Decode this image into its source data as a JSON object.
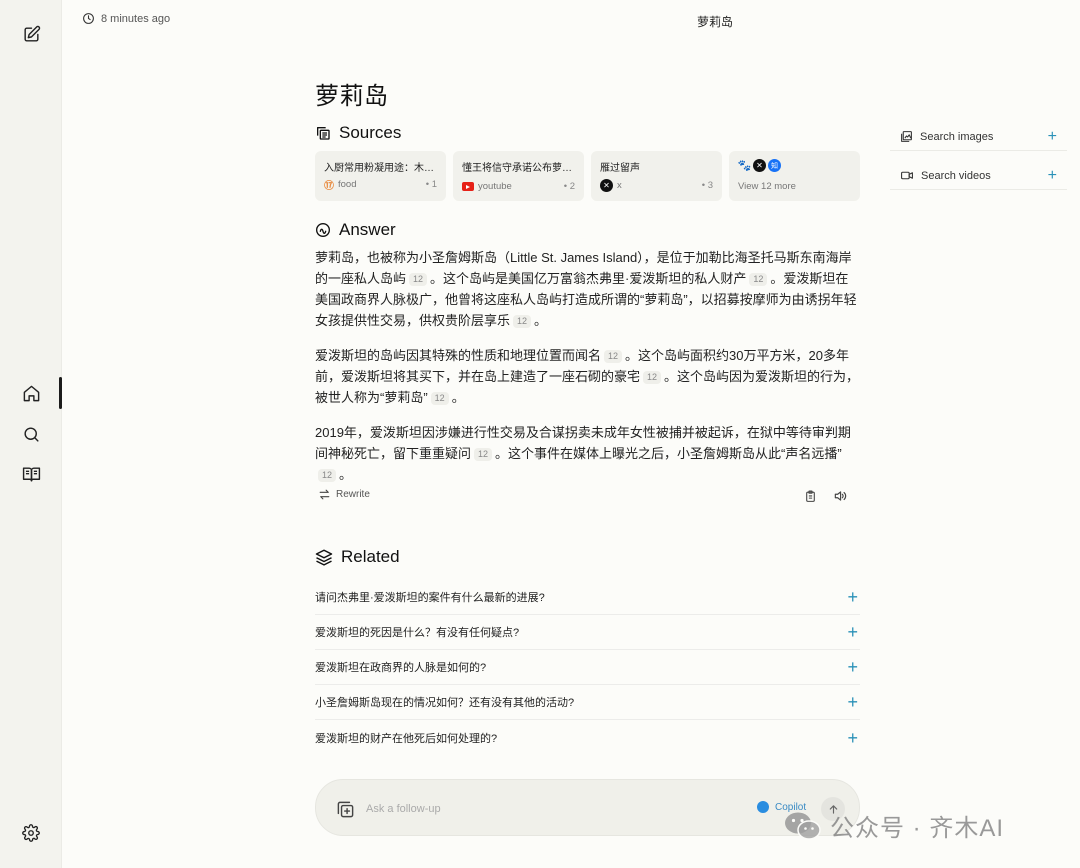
{
  "header": {
    "time_ago": "8 minutes ago",
    "thread_title": "萝莉岛"
  },
  "main": {
    "page_title": "萝莉岛",
    "sources_label": "Sources",
    "answer_label": "Answer",
    "related_label": "Related"
  },
  "sources": [
    {
      "title": "入厨常用粉凝用途：木薯...",
      "site": "food",
      "num": "• 1",
      "icon": "food-icon"
    },
    {
      "title": "懂王将信守承诺公布萝莉...",
      "site": "youtube",
      "num": "• 2",
      "icon": "youtube-icon"
    },
    {
      "title": "雁过留声",
      "site": "x",
      "num": "• 3",
      "icon": "x-icon"
    },
    {
      "view_more": "View 12 more",
      "icons": [
        "baidu-icon",
        "x-icon",
        "zhihu-icon"
      ]
    }
  ],
  "answer": {
    "p1_a": "萝莉岛，也被称为小圣詹姆斯岛（Little St. James Island），是位于加勒比海圣托马斯东南海岸的一座私人岛屿",
    "p1_c1": "12",
    "p1_b": "。这个岛屿是美国亿万富翁杰弗里·爱泼斯坦的私人财产",
    "p1_c2": "12",
    "p1_c": "。爱泼斯坦在美国政商界人脉极广，他曾将这座私人岛屿打造成所谓的“萝莉岛”，以招募按摩师为由诱拐年轻女孩提供性交易，供权贵阶层享乐",
    "p1_c3": "12",
    "p1_d": "。",
    "p2_a": "爱泼斯坦的岛屿因其特殊的性质和地理位置而闻名",
    "p2_c1": "12",
    "p2_b": "。这个岛屿面积约30万平方米，20多年前，爱泼斯坦将其买下，并在岛上建造了一座石砌的豪宅",
    "p2_c2": "12",
    "p2_c": "。这个岛屿因为爱泼斯坦的行为，被世人称为“萝莉岛”",
    "p2_c3": "12",
    "p2_d": "。",
    "p3_a": "2019年，爱泼斯坦因涉嫌进行性交易及合谋拐卖未成年女性被捕并被起诉，在狱中等待审判期间神秘死亡，留下重重疑问",
    "p3_c1": "12",
    "p3_b": "。这个事件在媒体上曝光之后，小圣詹姆斯岛从此“声名远播”",
    "p3_c2": "12",
    "p3_c": "。"
  },
  "actions": {
    "rewrite_label": "Rewrite"
  },
  "related": [
    "请问杰弗里·爱泼斯坦的案件有什么最新的进展?",
    "爱泼斯坦的死因是什么？有没有任何疑点?",
    "爱泼斯坦在政商界的人脉是如何的?",
    "小圣詹姆斯岛现在的情况如何？还有没有其他的活动?",
    "爱泼斯坦的财产在他死后如何处理的?"
  ],
  "right_panel": {
    "search_images": "Search images",
    "search_videos": "Search videos"
  },
  "followup": {
    "placeholder": "Ask a follow-up",
    "copilot_label": "Copilot"
  },
  "watermark": {
    "text": "公众号 · 齐木AI"
  },
  "colors": {
    "accent": "#2a91b8",
    "copilot": "#2a8de0",
    "background": "#fcfcf9",
    "sidebar": "#f3f3ee"
  }
}
